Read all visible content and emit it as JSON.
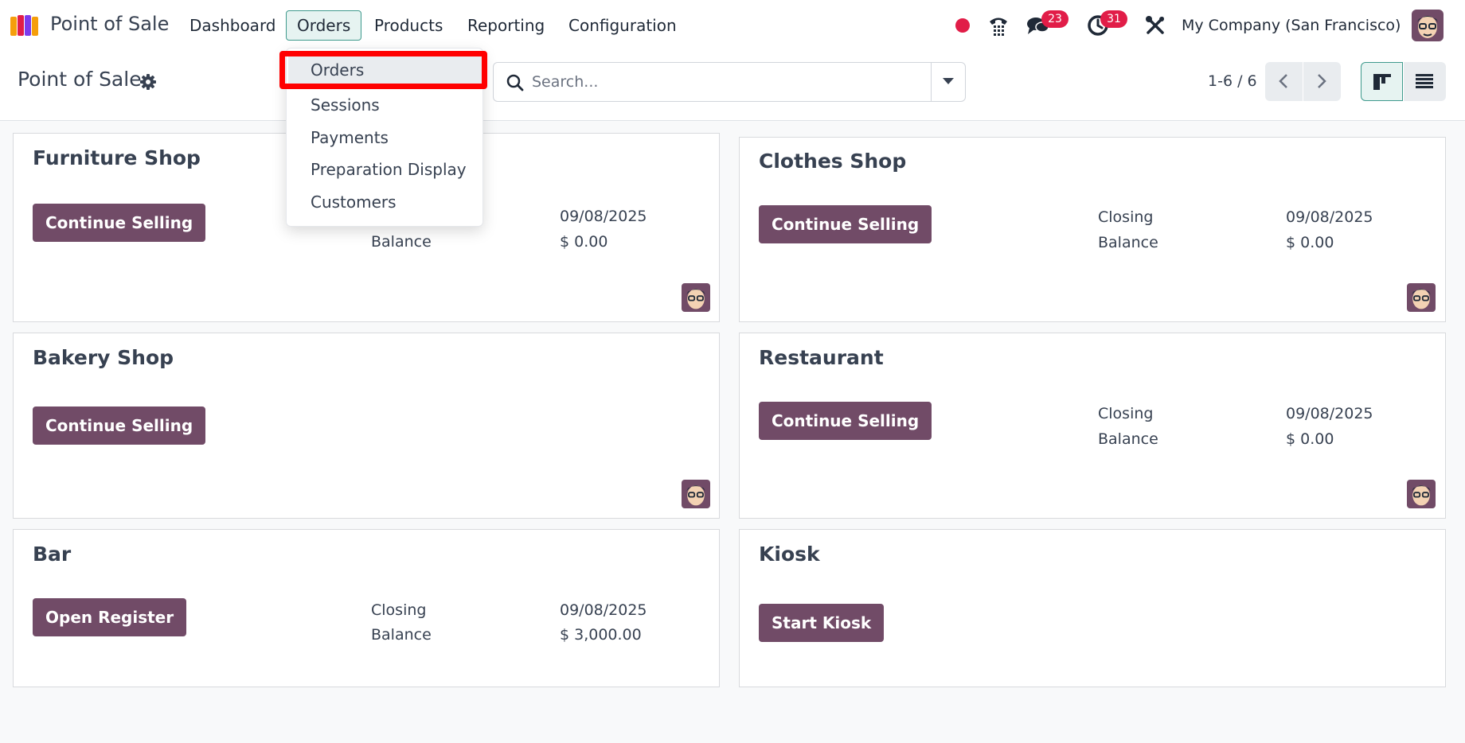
{
  "navbar": {
    "app_title": "Point of Sale",
    "menu": [
      "Dashboard",
      "Orders",
      "Products",
      "Reporting",
      "Configuration"
    ],
    "active_menu": "Orders",
    "messages_badge": "23",
    "activities_badge": "31",
    "company": "My Company (San Francisco)",
    "status_dot_color": "#e11d48",
    "accent_color": "#714b67"
  },
  "control_panel": {
    "title": "Point of Sale",
    "search_placeholder": "Search...",
    "pager": "1-6 / 6",
    "active_view": "kanban"
  },
  "dropdown": {
    "items": [
      "Orders",
      "Sessions",
      "Payments",
      "Preparation Display",
      "Customers"
    ],
    "highlighted": "Orders"
  },
  "cards": [
    {
      "title": "Furniture Shop",
      "button": "Continue Selling",
      "labels": [
        "",
        "Balance"
      ],
      "values": [
        "09/08/2025",
        "$ 0.00"
      ]
    },
    {
      "title": "Clothes Shop",
      "button": "Continue Selling",
      "labels": [
        "Closing",
        "Balance"
      ],
      "values": [
        "09/08/2025",
        "$ 0.00"
      ]
    },
    {
      "title": "Bakery Shop",
      "button": "Continue Selling"
    },
    {
      "title": "Restaurant",
      "button": "Continue Selling",
      "labels": [
        "Closing",
        "Balance"
      ],
      "values": [
        "09/08/2025",
        "$ 0.00"
      ]
    },
    {
      "title": "Bar",
      "button": "Open Register",
      "labels": [
        "Closing",
        "Balance"
      ],
      "values": [
        "09/08/2025",
        "$ 3,000.00"
      ]
    },
    {
      "title": "Kiosk",
      "button": "Start Kiosk"
    }
  ]
}
